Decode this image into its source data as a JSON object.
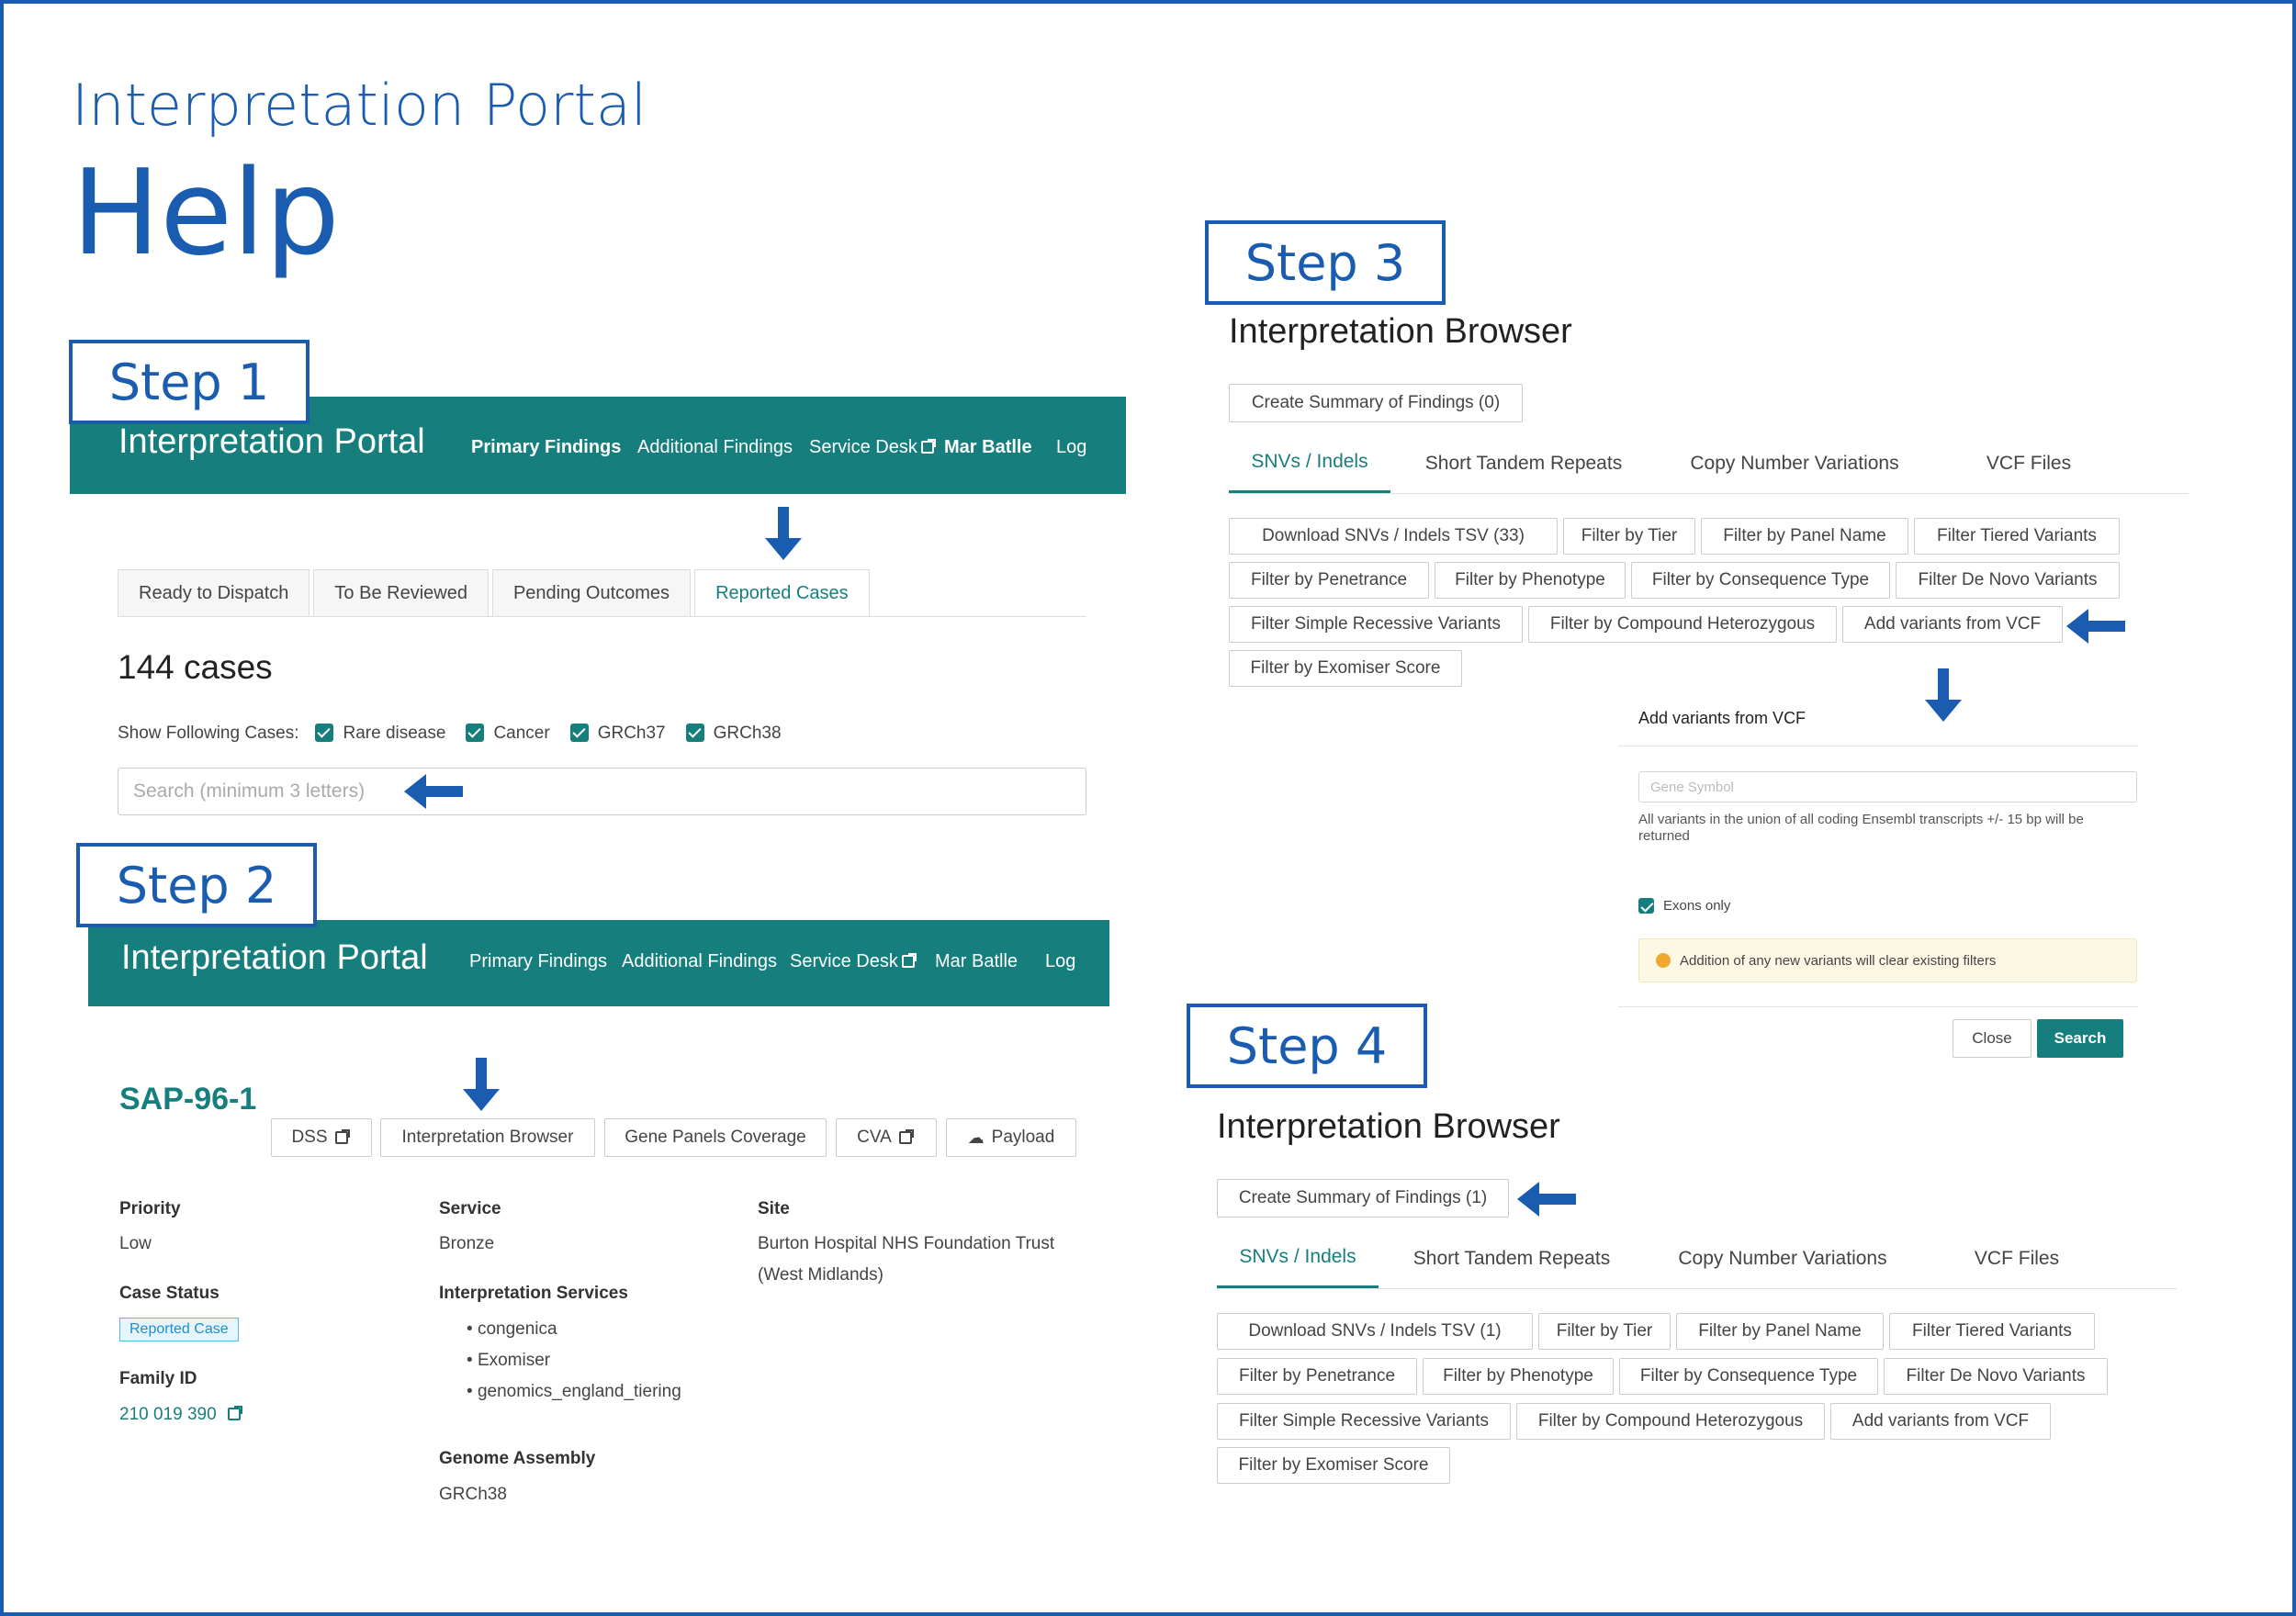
{
  "header": {
    "subtitle": "Interpretation Portal",
    "title": "Help"
  },
  "steps": {
    "s1": "Step 1",
    "s2": "Step 2",
    "s3": "Step 3",
    "s4": "Step 4"
  },
  "nav": {
    "brand": "Interpretation Portal",
    "primary": "Primary Findings",
    "additional": "Additional Findings",
    "service": "Service Desk",
    "user": "Mar Batlle",
    "log": "Log"
  },
  "step1": {
    "tabs": [
      "Ready to Dispatch",
      "To Be Reviewed",
      "Pending Outcomes",
      "Reported Cases"
    ],
    "count": "144 cases",
    "filter_label": "Show Following Cases:",
    "filters": [
      "Rare disease",
      "Cancer",
      "GRCh37",
      "GRCh38"
    ],
    "search_placeholder": "Search (minimum 3 letters)"
  },
  "step2": {
    "case_id": "SAP-96-1",
    "buttons": [
      "DSS",
      "Interpretation Browser",
      "Gene Panels Coverage",
      "CVA",
      "Payload"
    ],
    "priority_label": "Priority",
    "priority": "Low",
    "case_status_label": "Case Status",
    "case_status": "Reported Case",
    "family_label": "Family ID",
    "family": "210 019 390",
    "service_label": "Service",
    "service": "Bronze",
    "interp_label": "Interpretation Services",
    "interp": [
      "congenica",
      "Exomiser",
      "genomics_england_tiering"
    ],
    "genome_label": "Genome Assembly",
    "genome": "GRCh38",
    "site_label": "Site",
    "site_l1": "Burton Hospital NHS Foundation Trust",
    "site_l2": "(West Midlands)"
  },
  "browser": {
    "title": "Interpretation Browser",
    "summary3": "Create Summary of Findings (0)",
    "summary4": "Create Summary of Findings (1)",
    "tabs": [
      "SNVs / Indels",
      "Short Tandem Repeats",
      "Copy Number Variations",
      "VCF Files"
    ],
    "filters3": [
      "Download  SNVs / Indels  TSV (33)",
      "Filter by Tier",
      "Filter by Panel Name",
      "Filter Tiered Variants",
      "Filter by Penetrance",
      "Filter by Phenotype",
      "Filter by Consequence Type",
      "Filter De Novo Variants",
      "Filter Simple Recessive Variants",
      "Filter by Compound Heterozygous",
      "Add variants from VCF",
      "Filter by Exomiser Score"
    ],
    "filters4": [
      "Download  SNVs / Indels  TSV (1)",
      "Filter by Tier",
      "Filter by Panel Name",
      "Filter Tiered Variants",
      "Filter by Penetrance",
      "Filter by Phenotype",
      "Filter by Consequence Type",
      "Filter De Novo Variants",
      "Filter Simple Recessive Variants",
      "Filter by Compound Heterozygous",
      "Add variants from VCF",
      "Filter by Exomiser Score"
    ]
  },
  "modal": {
    "title": "Add variants from VCF",
    "gene_placeholder": "Gene Symbol",
    "help": "All variants in the union of all coding Ensembl transcripts +/- 15 bp will be returned",
    "exons": "Exons only",
    "warning": "Addition of any new variants will clear existing filters",
    "close": "Close",
    "search": "Search"
  }
}
